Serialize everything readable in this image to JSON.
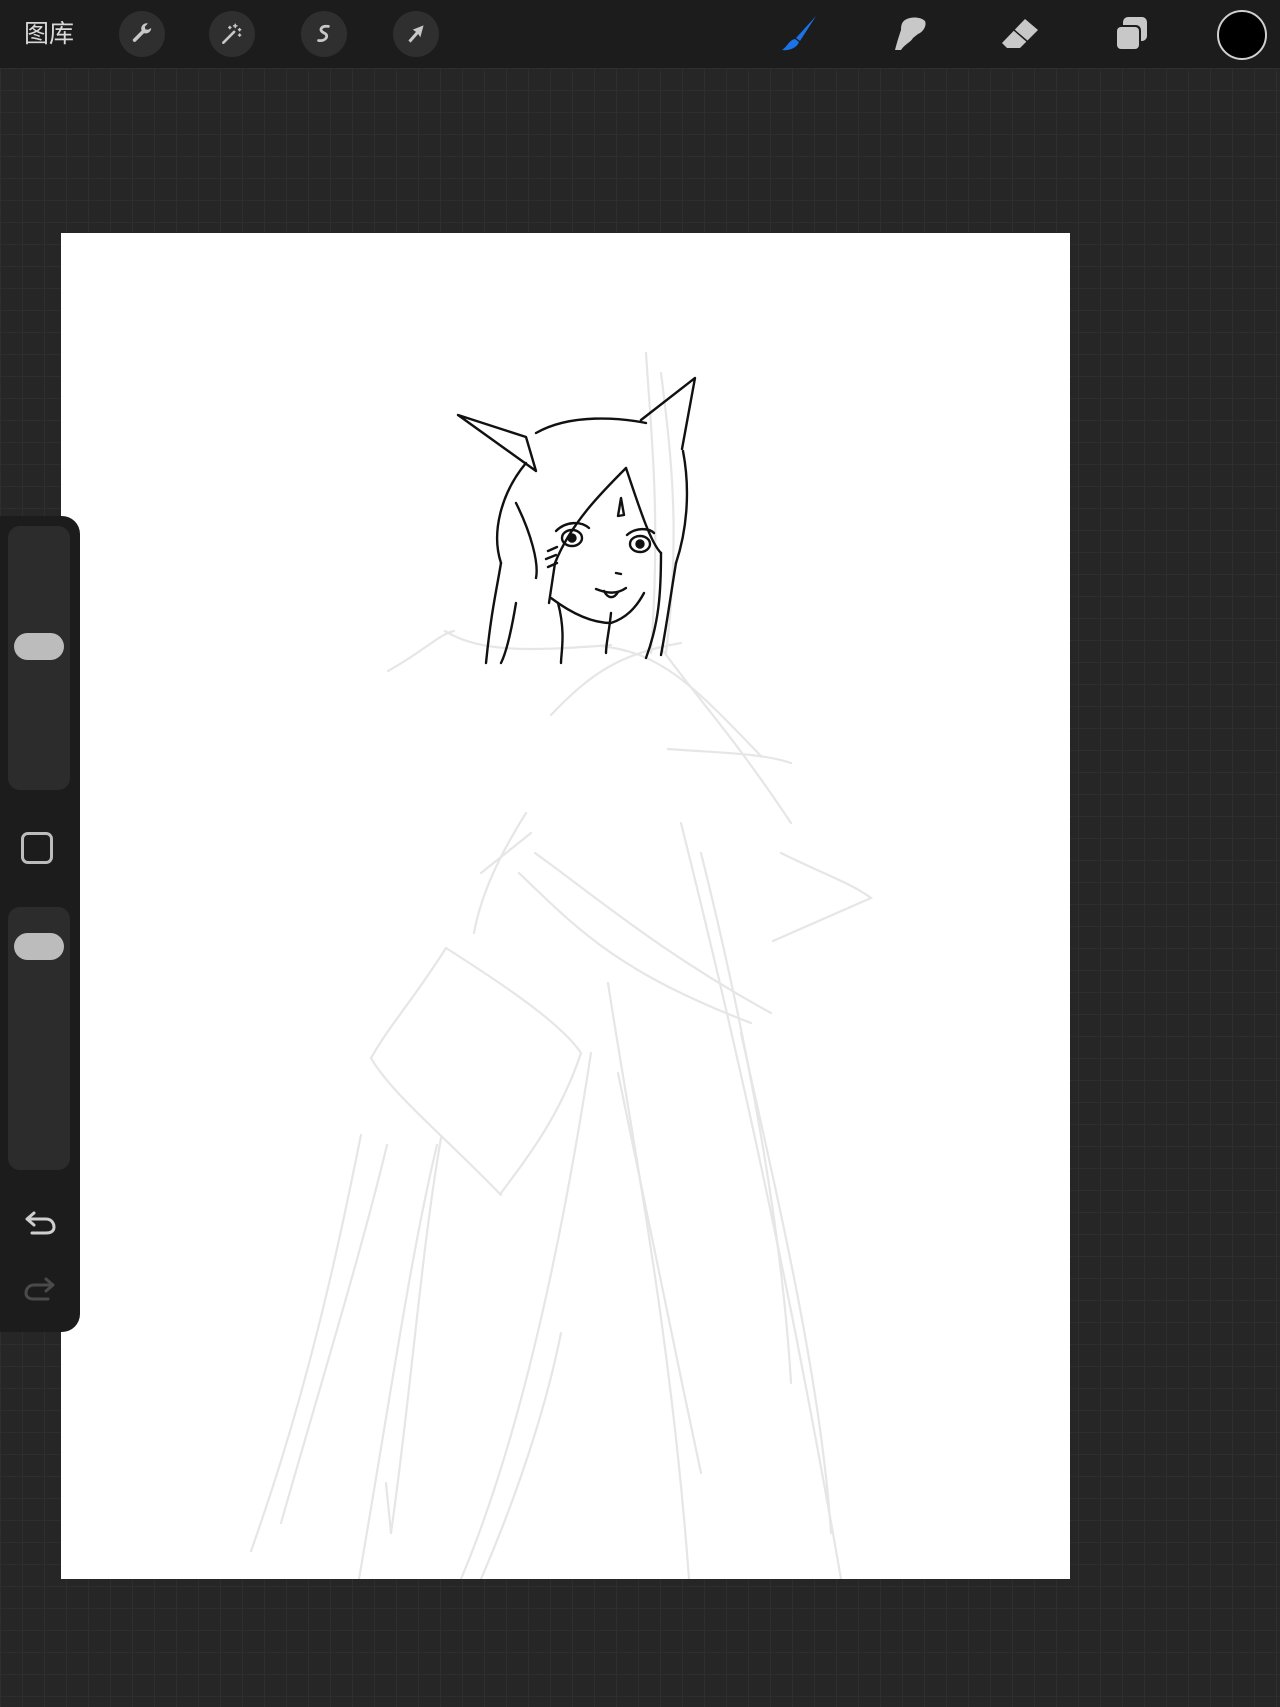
{
  "toolbar": {
    "gallery_label": "图库",
    "left_tools": [
      {
        "name": "actions",
        "icon": "wrench-icon"
      },
      {
        "name": "adjustments",
        "icon": "magic-wand-icon"
      },
      {
        "name": "selection",
        "icon": "selection-s-icon"
      },
      {
        "name": "transform",
        "icon": "arrow-cursor-icon"
      }
    ],
    "right_tools": [
      {
        "name": "brush",
        "icon": "brush-icon",
        "active": true
      },
      {
        "name": "smudge",
        "icon": "smudge-icon",
        "active": false
      },
      {
        "name": "eraser",
        "icon": "eraser-icon",
        "active": false
      },
      {
        "name": "layers",
        "icon": "layers-icon",
        "active": false
      }
    ],
    "current_color": "#000000",
    "active_color": "#1a73e8"
  },
  "sidebar": {
    "brush_size": 0.55,
    "brush_opacity": 0.92,
    "undo_icon": "undo-icon",
    "redo_icon": "redo-icon",
    "modify_icon": "square-icon"
  }
}
